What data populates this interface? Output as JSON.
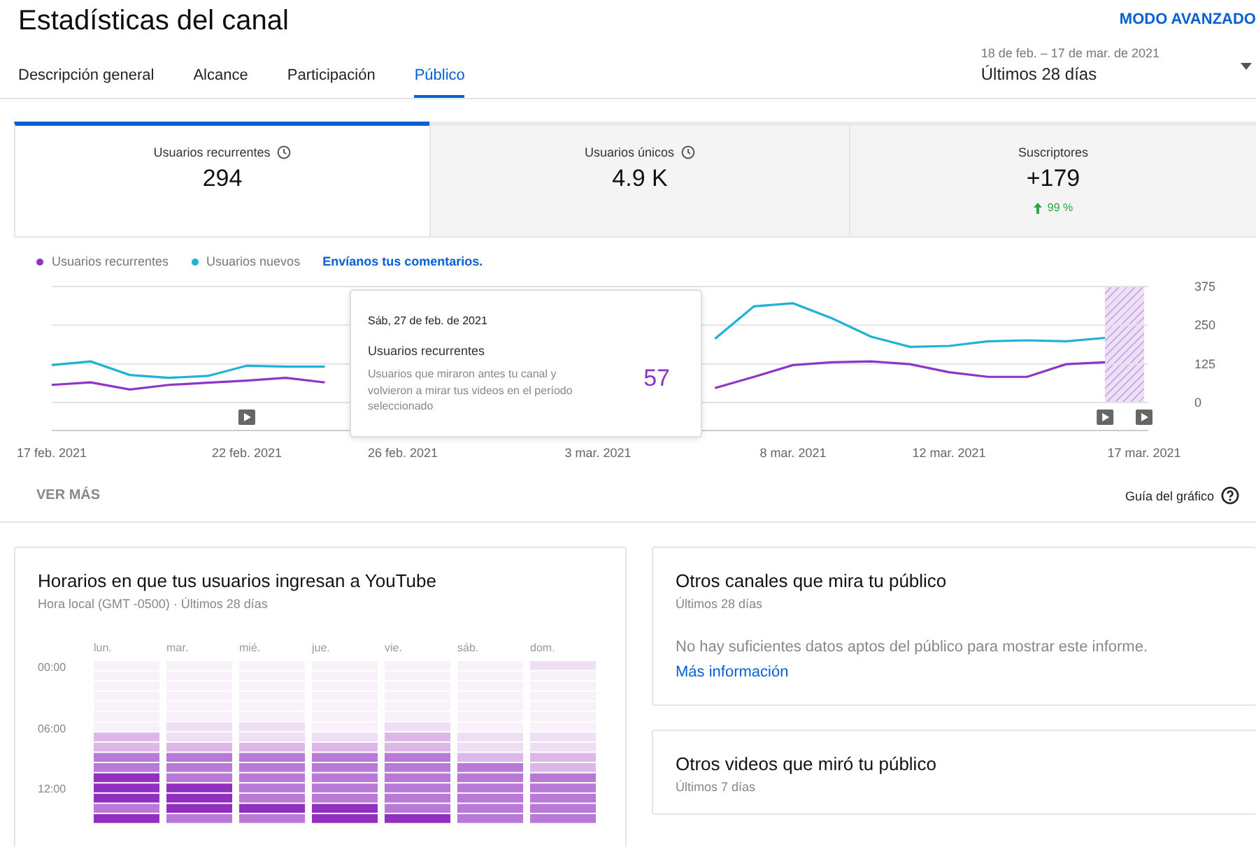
{
  "header": {
    "title": "Estadísticas del canal",
    "advanced_mode": "MODO AVANZADO"
  },
  "tabs": [
    {
      "label": "Descripción general",
      "selected": false
    },
    {
      "label": "Alcance",
      "selected": false
    },
    {
      "label": "Participación",
      "selected": false
    },
    {
      "label": "Público",
      "selected": true
    }
  ],
  "date_range": {
    "range": "18 de feb. – 17 de mar. de 2021",
    "period": "Últimos 28 días"
  },
  "metrics": [
    {
      "label": "Usuarios recurrentes",
      "value": "294",
      "info_icon": true,
      "selected": true
    },
    {
      "label": "Usuarios únicos",
      "value": "4.9 K",
      "info_icon": true,
      "selected": false
    },
    {
      "label": "Suscriptores",
      "value": "+179",
      "info_icon": false,
      "selected": false,
      "change": "99 %"
    }
  ],
  "chart": {
    "feedback_link": "Envíanos tus comentarios.",
    "chart_data": {
      "type": "line",
      "categories": [
        "17 feb. 2021",
        null,
        null,
        null,
        null,
        "22 feb. 2021",
        null,
        null,
        null,
        "26 feb. 2021",
        null,
        null,
        null,
        null,
        "3 mar. 2021",
        null,
        null,
        null,
        null,
        "8 mar. 2021",
        null,
        null,
        null,
        "12 mar. 2021",
        null,
        null,
        null,
        null,
        "17 mar. 2021"
      ],
      "series": [
        {
          "name": "Usuarios recurrentes",
          "color": "#8e35c8",
          "values": [
            57,
            65,
            42,
            57,
            64,
            71,
            80,
            65,
            null,
            null,
            null,
            null,
            null,
            null,
            null,
            null,
            null,
            47,
            83,
            121,
            130,
            133,
            124,
            98,
            83,
            83,
            124,
            130,
            null
          ]
        },
        {
          "name": "Usuarios nuevos",
          "color": "#1fb1d6",
          "values": [
            121,
            133,
            89,
            80,
            86,
            119,
            116,
            116,
            null,
            null,
            null,
            null,
            null,
            null,
            null,
            null,
            null,
            206,
            311,
            321,
            272,
            213,
            180,
            183,
            198,
            201,
            198,
            209,
            null
          ]
        }
      ],
      "ylim": [
        0,
        375
      ],
      "yticks": [
        0,
        125,
        250,
        375
      ]
    },
    "tooltip": {
      "date": "Sáb, 27 de feb. de 2021",
      "metric": "Usuarios recurrentes",
      "description": "Usuarios que miraron antes tu canal y volvieron a mirar tus videos en el período seleccionado",
      "value": "57"
    },
    "see_more": "VER MÁS",
    "guide": "Guía del gráfico"
  },
  "heatmap_card": {
    "title": "Horarios en que tus usuarios ingresan a YouTube",
    "subtitle": "Hora local (GMT -0500) · Últimos 28 días",
    "days": [
      "lun.",
      "mar.",
      "mié.",
      "jue.",
      "vie.",
      "sáb.",
      "dom."
    ],
    "hours": [
      "00:00",
      "06:00",
      "12:00"
    ]
  },
  "channels_card": {
    "title": "Otros canales que mira tu público",
    "subtitle": "Últimos 28 días",
    "message": "No hay suficientes datos aptos del público para mostrar este informe.",
    "link": "Más información"
  },
  "videos_card": {
    "title": "Otros videos que miró tu público",
    "subtitle": "Últimos 7 días"
  }
}
